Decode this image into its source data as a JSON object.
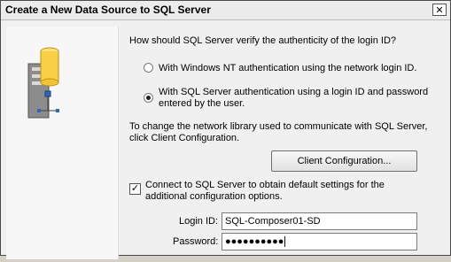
{
  "window": {
    "title": "Create a New Data Source to SQL Server",
    "close_label": "✕"
  },
  "question": "How should SQL Server verify the authenticity of the login ID?",
  "auth": {
    "option_windows": "With Windows NT authentication using the network login ID.",
    "option_sql_line1": "With SQL Server authentication using a login ID and password",
    "option_sql_line2": "entered by the user.",
    "selected": "sql"
  },
  "network_library": {
    "line1": "To change the network library used to communicate with SQL Server,",
    "line2": "click Client Configuration.",
    "button_label": "Client Configuration..."
  },
  "connect": {
    "checked": true,
    "check_mark": "✓",
    "line1": "Connect to SQL Server to obtain default settings for the",
    "line2": "additional configuration options."
  },
  "fields": {
    "login_label": "Login ID:",
    "login_value": "SQL-Composer01-SD",
    "password_label": "Password:",
    "password_value": "●●●●●●●●●●"
  },
  "icons": {
    "title_close": "close-icon",
    "illustration": "server-database-network-icon"
  }
}
